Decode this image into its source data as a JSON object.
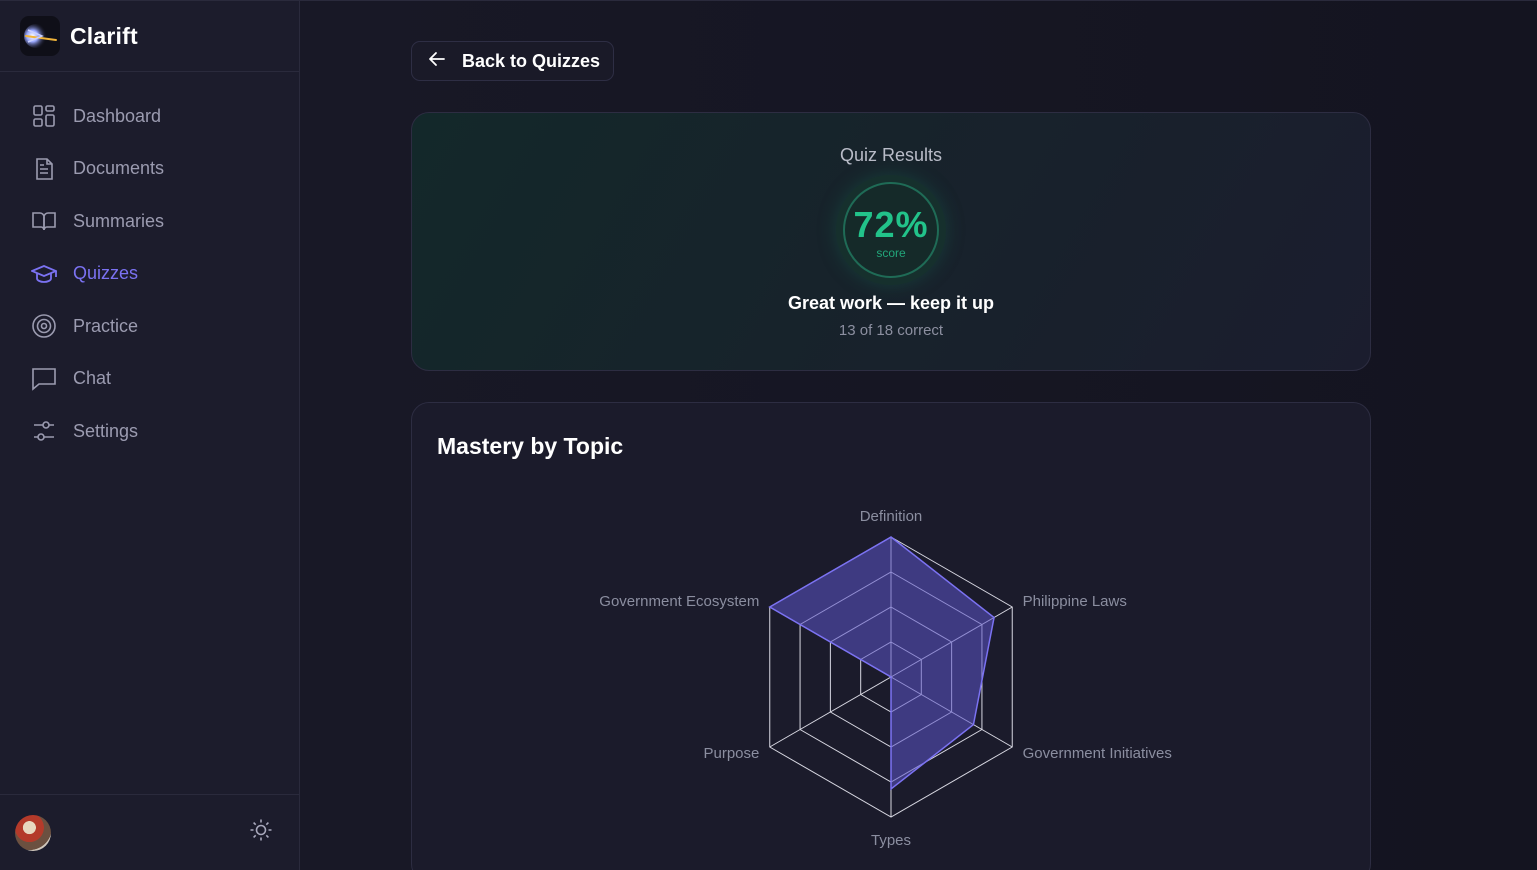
{
  "app": {
    "name": "Clarift"
  },
  "sidebar": {
    "items": [
      {
        "label": "Dashboard",
        "icon": "dashboard-icon",
        "active": false
      },
      {
        "label": "Documents",
        "icon": "document-icon",
        "active": false
      },
      {
        "label": "Summaries",
        "icon": "book-icon",
        "active": false
      },
      {
        "label": "Quizzes",
        "icon": "graduation-cap-icon",
        "active": true
      },
      {
        "label": "Practice",
        "icon": "target-icon",
        "active": false
      },
      {
        "label": "Chat",
        "icon": "chat-bubble-icon",
        "active": false
      },
      {
        "label": "Settings",
        "icon": "sliders-icon",
        "active": false
      }
    ]
  },
  "back_button": {
    "label": "Back to Quizzes"
  },
  "results": {
    "title": "Quiz Results",
    "score": "72%",
    "score_label": "score",
    "message": "Great work — keep it up",
    "count": "13 of 18 correct"
  },
  "mastery": {
    "title": "Mastery by Topic"
  },
  "colors": {
    "accent": "#7b72f2",
    "score_green": "#22c38a",
    "radar_fill": "#5b54c9"
  },
  "chart_data": {
    "type": "radar",
    "categories": [
      "Definition",
      "Philippine Laws",
      "Government Initiatives",
      "Types",
      "Purpose",
      "Government Ecosystem"
    ],
    "values": [
      100,
      85,
      68,
      80,
      0,
      100
    ],
    "ylim": [
      0,
      100
    ],
    "grid": true
  }
}
